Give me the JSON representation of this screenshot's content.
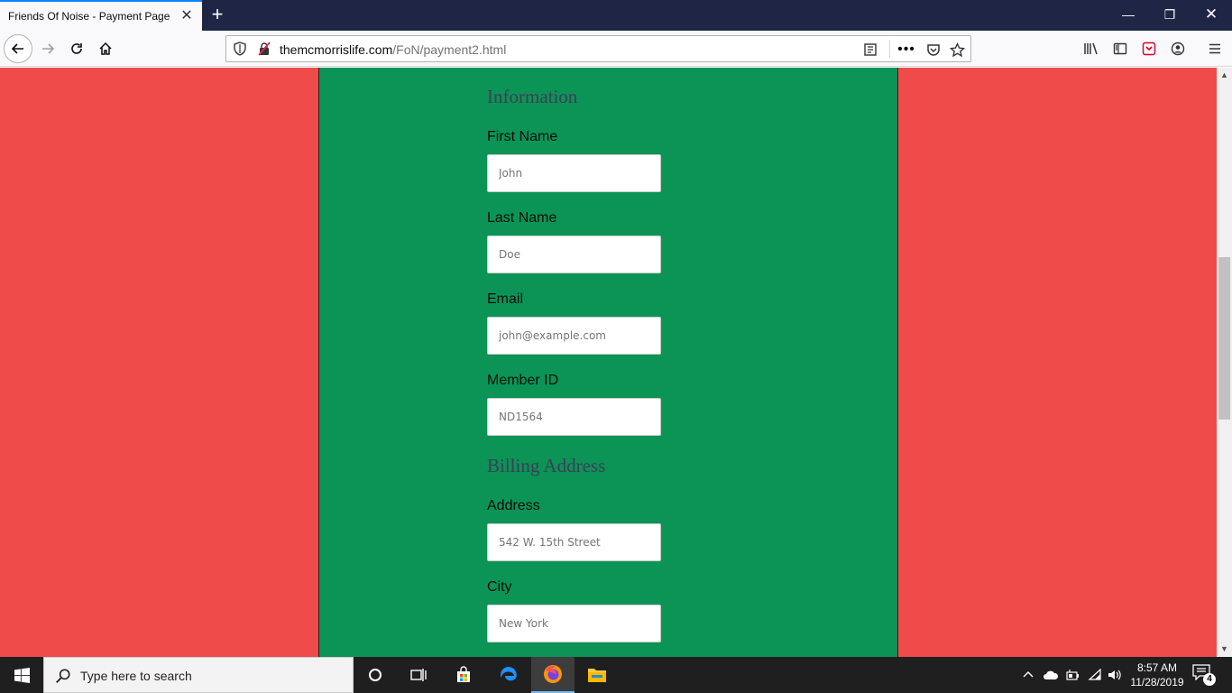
{
  "browser": {
    "tab_title": "Friends Of Noise - Payment Page",
    "tab_close": "✕",
    "new_tab": "+",
    "url_domain": "themcmorrislife.com",
    "url_path": "/FoN/payment2.html",
    "more_label": "•••"
  },
  "window": {
    "minimize": "—",
    "maximize": "❐",
    "close": "✕"
  },
  "form": {
    "information_heading": "Information",
    "billing_heading": "Billing Address",
    "fields": [
      {
        "label": "First Name",
        "placeholder": "John"
      },
      {
        "label": "Last Name",
        "placeholder": "Doe"
      },
      {
        "label": "Email",
        "placeholder": "john@example.com"
      },
      {
        "label": "Member ID",
        "placeholder": "ND1564"
      },
      {
        "label": "Address",
        "placeholder": "542 W. 15th Street"
      },
      {
        "label": "City",
        "placeholder": "New York"
      }
    ]
  },
  "taskbar": {
    "search_placeholder": "Type here to search",
    "time": "8:57 AM",
    "date": "11/28/2019",
    "notification_count": "4"
  },
  "colors": {
    "page_background": "#ef4b4a",
    "content_background": "#0b9455",
    "heading_color": "#3d3d5a"
  },
  "icons": [
    "back-arrow-icon",
    "forward-arrow-icon",
    "reload-icon",
    "home-icon",
    "shield-icon",
    "insecure-lock-icon",
    "reader-view-icon",
    "pocket-icon",
    "bookmark-star-icon",
    "library-icon",
    "sidebar-icon",
    "account-icon",
    "hamburger-menu-icon",
    "windows-logo-icon",
    "search-icon",
    "cortana-icon",
    "task-view-icon",
    "store-icon",
    "edge-icon",
    "firefox-icon",
    "file-explorer-icon",
    "chevron-up-icon",
    "onedrive-cloud-icon",
    "battery-icon",
    "wifi-icon",
    "volume-icon",
    "notification-icon"
  ]
}
